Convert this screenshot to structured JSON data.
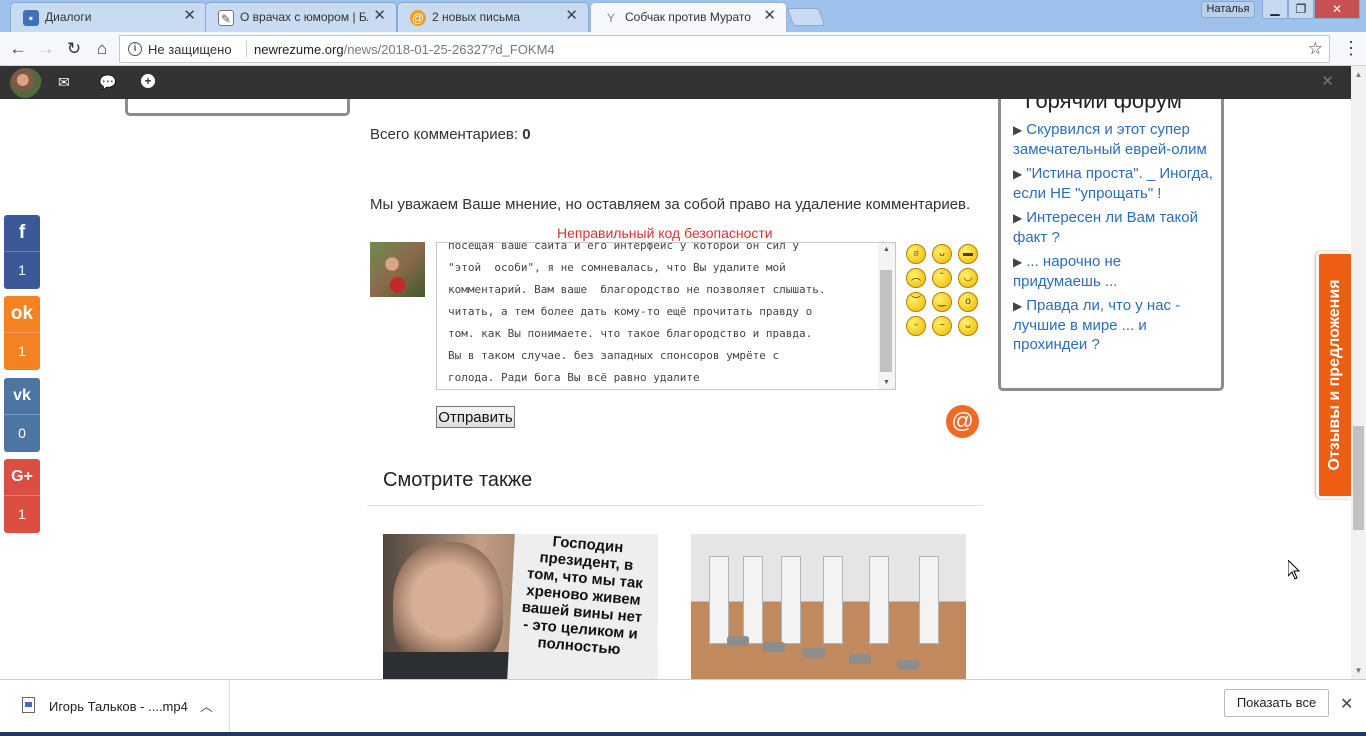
{
  "browser": {
    "tabs": [
      {
        "title": "Диалоги",
        "icon": "chat-icon",
        "color": "#3f71b8"
      },
      {
        "title": "О врачах с юмором | Бл",
        "icon": "page-icon",
        "color": "#555555"
      },
      {
        "title": "2 новых письма",
        "icon": "mail-icon",
        "color": "#f0a020"
      },
      {
        "title": "Собчак против Мурато",
        "icon": "y-icon",
        "color": "#888888"
      }
    ],
    "profile_name": "Наталья",
    "security_label": "Не защищено",
    "url_host": "newrezume.org",
    "url_path": "/news/2018-01-25-26327?d_FOKM4"
  },
  "comments": {
    "total_label": "Всего комментариев:",
    "total_count": "0",
    "notice": "Мы уважаем Ваше мнение, но оставляем за собой право на удаление комментариев.",
    "error": "Неправильный код безопасности",
    "draft_text": "посещая ваше сайта и его интерфейс у которой он сил у\n\"этой  особи\", я не сомневалась, что Вы удалите мой\nкомментарий. Вам ваше  благородство не позволяет слышать.\nчитать, а тем более дать кому-то ещё прочитать правду о\nтом. как Вы понимаете. что такое благородство и правда.\nВы в таком случае. без западных спонсоров умрёте с\nголода. Ради бога Вы всё равно удалите",
    "send_label": "Отправить",
    "at_label": "@"
  },
  "see_also": {
    "title": "Смотрите также",
    "poster_text": "Господин президент, в том, что мы так хреново живем вашей вины нет - это целиком и полностью"
  },
  "forum": {
    "title": "Горячий форум",
    "items": [
      "Скурвился и этот супер замечательный еврей-олим",
      "\"Истина проста\". _ Иногда, если НЕ \"упрощать\" !",
      "Интересен ли Вам такой факт ?",
      "... нарочно не придумаешь ...",
      "Правда ли, что у нас - лучшие в мире ... и прохиндеи ?"
    ]
  },
  "social": [
    {
      "network": "facebook",
      "icon": "f",
      "count": "1",
      "color": "#3b5998"
    },
    {
      "network": "odnoklassniki",
      "icon": "ok",
      "count": "1",
      "color": "#f58220"
    },
    {
      "network": "vkontakte",
      "icon": "vk",
      "count": "0",
      "color": "#4c75a3"
    },
    {
      "network": "google-plus",
      "icon": "G+",
      "count": "1",
      "color": "#dc4e41"
    }
  ],
  "feedback_label": "Отзывы и предложения",
  "download": {
    "file_name": "Игорь Тальков - ....mp4",
    "show_all": "Показать все"
  }
}
